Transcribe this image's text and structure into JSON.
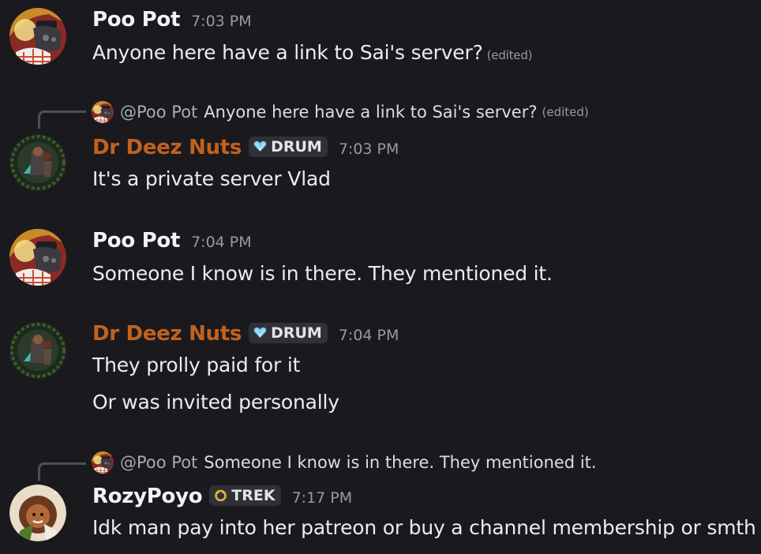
{
  "messages": [
    {
      "id": "m1",
      "username": "Poo Pot",
      "timestamp": "7:03 PM",
      "lines": [
        "Anyone here have a link to Sai's server?"
      ],
      "edited_label": "(edited)"
    },
    {
      "id": "m2",
      "reply_to": {
        "mention": "@Poo Pot",
        "text": "Anyone here have a link to Sai's server?",
        "edited_label": "(edited)"
      },
      "username": "Dr Deez Nuts",
      "username_color": "#c2611e",
      "tag": {
        "icon": "diamond-heart-icon",
        "label": "DRUM"
      },
      "timestamp": "7:03 PM",
      "lines": [
        "It's a private server Vlad"
      ]
    },
    {
      "id": "m3",
      "username": "Poo Pot",
      "timestamp": "7:04 PM",
      "lines": [
        "Someone I know is in there. They mentioned it."
      ]
    },
    {
      "id": "m4",
      "username": "Dr Deez Nuts",
      "username_color": "#c2611e",
      "tag": {
        "icon": "diamond-heart-icon",
        "label": "DRUM"
      },
      "timestamp": "7:04 PM",
      "lines": [
        "They prolly paid for it",
        "Or was invited personally"
      ]
    },
    {
      "id": "m5",
      "reply_to": {
        "mention": "@Poo Pot",
        "text": "Someone I know is in there. They mentioned it."
      },
      "username": "RozyPoyo",
      "tag": {
        "icon": "gold-ring-icon",
        "label": "TREK"
      },
      "timestamp": "7:17 PM",
      "lines": [
        "Idk man pay into her patreon or buy a channel membership or smth"
      ]
    }
  ],
  "colors": {
    "background": "#1a1a1e",
    "username_default": "#f2f3f5",
    "username_orange": "#c2611e",
    "muted": "#949ba4",
    "tag_bg": "#303136"
  }
}
